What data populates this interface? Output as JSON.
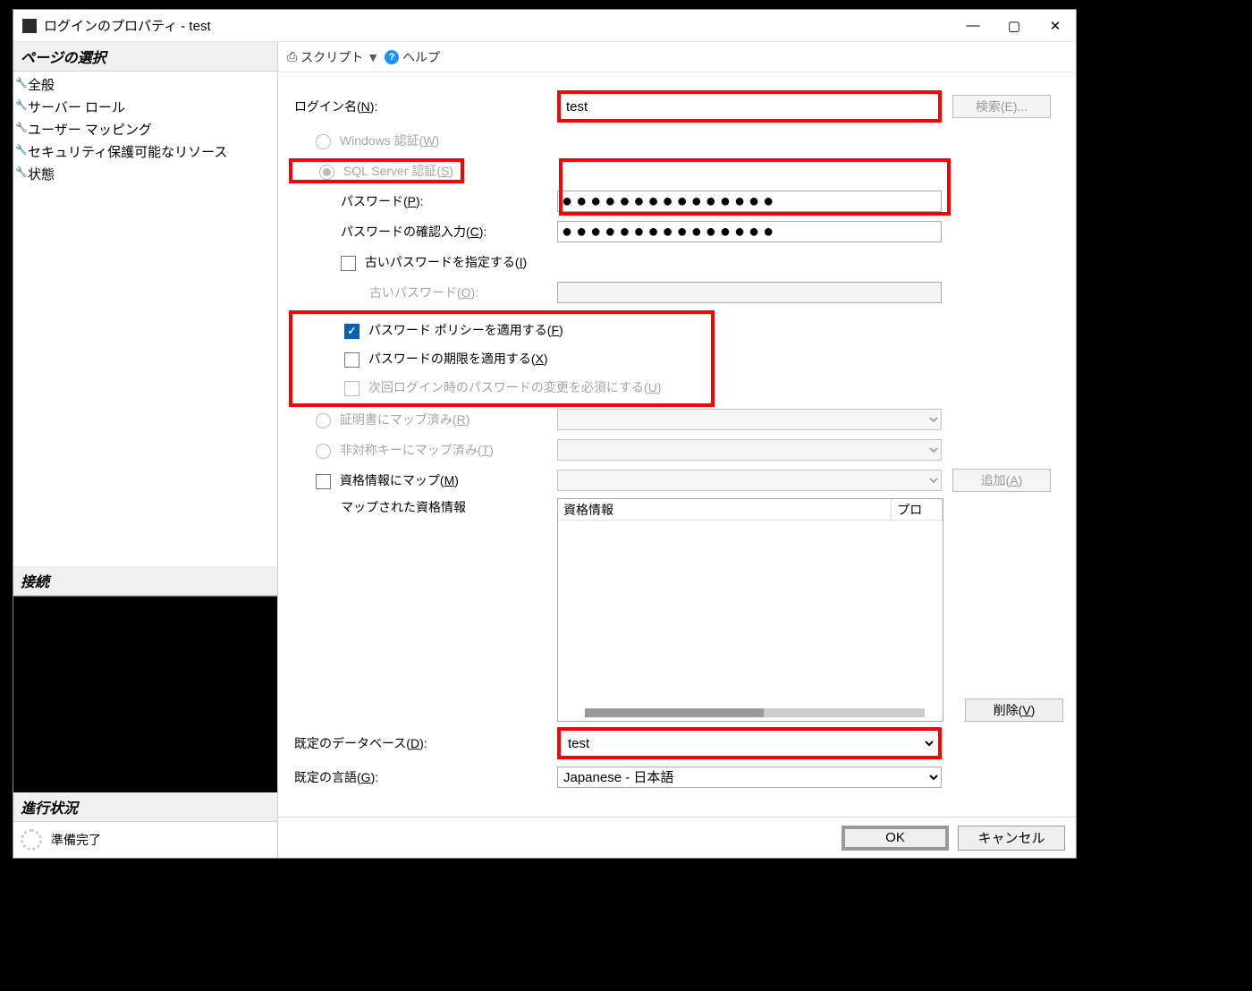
{
  "title": "ログインのプロパティ - test",
  "left": {
    "page_select": "ページの選択",
    "nav": [
      "全般",
      "サーバー ロール",
      "ユーザー マッピング",
      "セキュリティ保護可能なリソース",
      "状態"
    ],
    "connection_header": "接続",
    "progress_header": "進行状況",
    "progress_status": "準備完了"
  },
  "toolbar": {
    "script": "スクリプト",
    "help": "ヘルプ"
  },
  "form": {
    "login_name_label": "ログイン名(N):",
    "login_name_value": "test",
    "search_btn": "検索(E)...",
    "windows_auth": "Windows 認証(W)",
    "sql_auth": "SQL Server 認証(S)",
    "password_label": "パスワード(P):",
    "password_value": "●●●●●●●●●●●●●●●",
    "confirm_label": "パスワードの確認入力(C):",
    "confirm_value": "●●●●●●●●●●●●●●●",
    "specify_old": "古いパスワードを指定する(I)",
    "old_pw_label": "古いパスワード(O):",
    "enforce_policy": "パスワード ポリシーを適用する(F)",
    "enforce_expire": "パスワードの期限を適用する(X)",
    "must_change": "次回ログイン時のパスワードの変更を必須にする(U)",
    "mapped_cert": "証明書にマップ済み(R)",
    "mapped_asym": "非対称キーにマップ済み(T)",
    "map_cred": "資格情報にマップ(M)",
    "add_btn": "追加(A)",
    "mapped_creds_label": "マップされた資格情報",
    "cred_col1": "資格情報",
    "cred_col2": "プロ",
    "remove_btn": "削除(V)",
    "default_db_label": "既定のデータベース(D):",
    "default_db_value": "test",
    "default_lang_label": "既定の言語(G):",
    "default_lang_value": "Japanese - 日本語"
  },
  "footer": {
    "ok": "OK",
    "cancel": "キャンセル"
  }
}
